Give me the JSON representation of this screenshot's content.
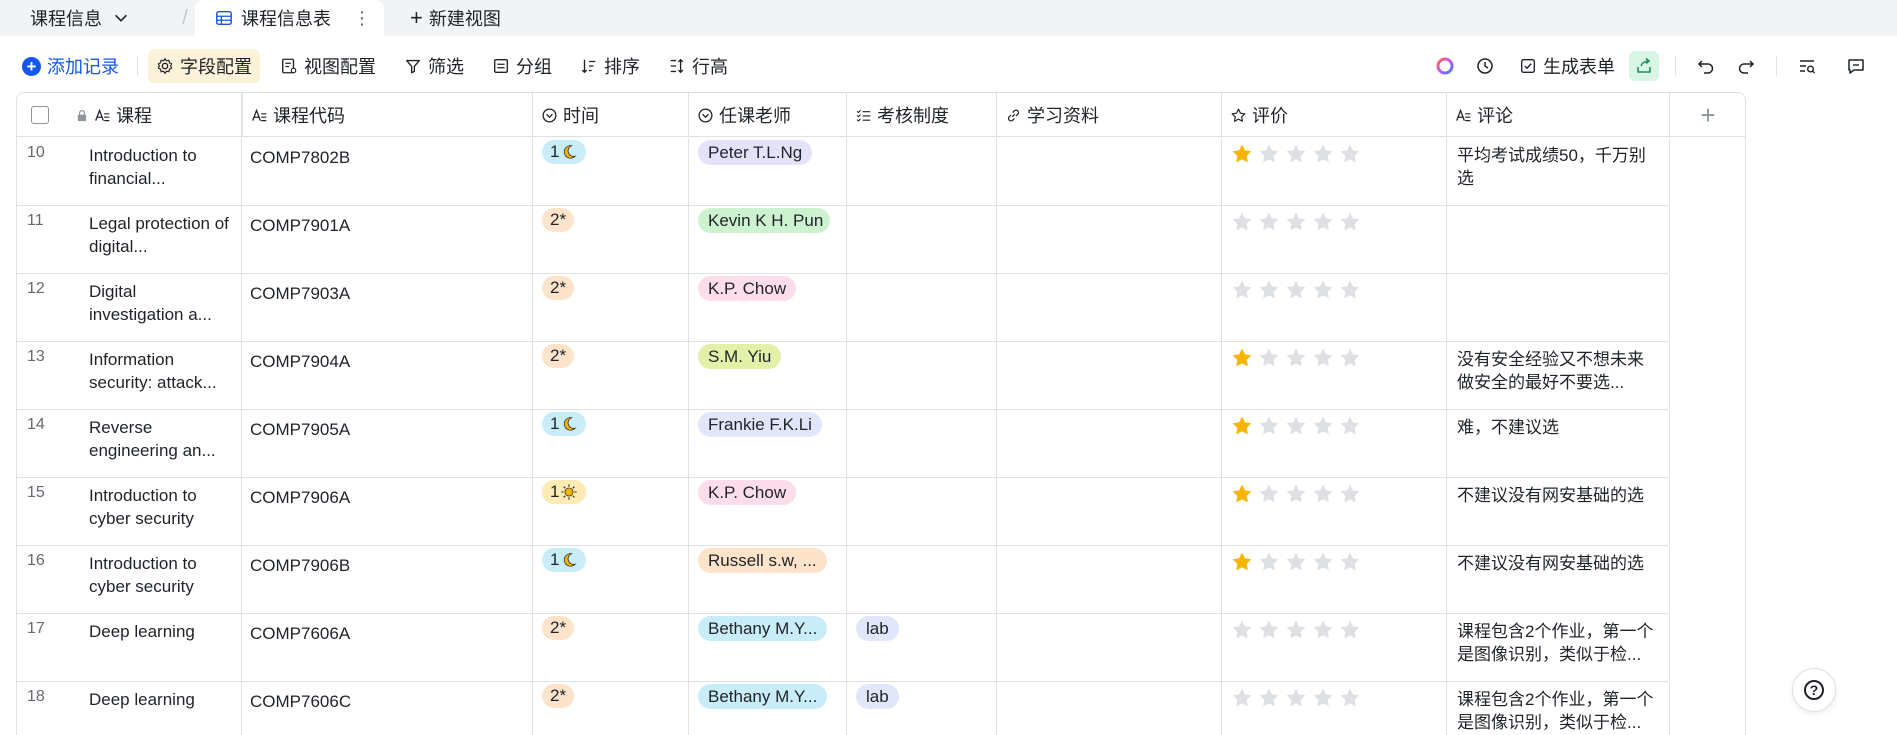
{
  "tabs": {
    "doc_title": "课程信息",
    "active_tab": "课程信息表",
    "new_view": "新建视图",
    "more": "⋮"
  },
  "toolbar": {
    "add_record": "添加记录",
    "field_config": "字段配置",
    "view_config": "视图配置",
    "filter": "筛选",
    "group": "分组",
    "sort": "排序",
    "row_height": "行高",
    "generate_form": "生成表单"
  },
  "columns": [
    "课程",
    "课程代码",
    "时间",
    "任课老师",
    "考核制度",
    "学习资料",
    "评价",
    "评论"
  ],
  "colors": {
    "accent": "#1456f0",
    "star_on": "#f7b500",
    "star_off": "#dee0e3",
    "tag_moon": "#c8ecf8",
    "tag_star": "#fde3c9",
    "tag_sun": "#fdebb3"
  },
  "rows": [
    {
      "num": "10",
      "course": "Introduction to financial...",
      "code": "COMP7802B",
      "time": "1",
      "time_icon": "moon-icon",
      "teacher": "Peter T.L.Ng",
      "teacher_color": "#e4e1fb",
      "exam": "",
      "rating": 1,
      "comment": "平均考试成绩50，千万别选"
    },
    {
      "num": "11",
      "course": "Legal protection of digital...",
      "code": "COMP7901A",
      "time": "2*",
      "time_icon": "",
      "teacher": "Kevin K H. Pun",
      "teacher_color": "#cdf2cf",
      "exam": "",
      "rating": 0,
      "comment": ""
    },
    {
      "num": "12",
      "course": "Digital investigation a...",
      "code": "COMP7903A",
      "time": "2*",
      "time_icon": "",
      "teacher": "K.P. Chow",
      "teacher_color": "#fcdde9",
      "exam": "",
      "rating": 0,
      "comment": ""
    },
    {
      "num": "13",
      "course": "Information security: attack...",
      "code": "COMP7904A",
      "time": "2*",
      "time_icon": "",
      "teacher": "S.M. Yiu",
      "teacher_color": "#e3f0a8",
      "exam": "",
      "rating": 1,
      "comment": "没有安全经验又不想未来做安全的最好不要选..."
    },
    {
      "num": "14",
      "course": "Reverse engineering an...",
      "code": "COMP7905A",
      "time": "1",
      "time_icon": "moon-icon",
      "teacher": "Frankie F.K.Li",
      "teacher_color": "#e1e6fb",
      "exam": "",
      "rating": 1,
      "comment": "难，不建议选"
    },
    {
      "num": "15",
      "course": "Introduction to cyber security",
      "code": "COMP7906A",
      "time": "1",
      "time_icon": "sun-icon",
      "teacher": "K.P. Chow",
      "teacher_color": "#fcdde9",
      "exam": "",
      "rating": 1,
      "comment": "不建议没有网安基础的选"
    },
    {
      "num": "16",
      "course": "Introduction to cyber security",
      "code": "COMP7906B",
      "time": "1",
      "time_icon": "moon-icon",
      "teacher": "Russell s.w, ...",
      "teacher_color": "#fde3c9",
      "exam": "",
      "rating": 1,
      "comment": "不建议没有网安基础的选"
    },
    {
      "num": "17",
      "course": "Deep learning",
      "code": "COMP7606A",
      "time": "2*",
      "time_icon": "",
      "teacher": "Bethany M.Y...",
      "teacher_color": "#c8ecf8",
      "exam": "lab",
      "rating": 0,
      "comment": "课程包含2个作业，第一个是图像识别，类似于检..."
    },
    {
      "num": "18",
      "course": "Deep learning",
      "code": "COMP7606C",
      "time": "2*",
      "time_icon": "",
      "teacher": "Bethany M.Y...",
      "teacher_color": "#c8ecf8",
      "exam": "lab",
      "rating": 0,
      "comment": "课程包含2个作业，第一个是图像识别，类似于检..."
    }
  ]
}
